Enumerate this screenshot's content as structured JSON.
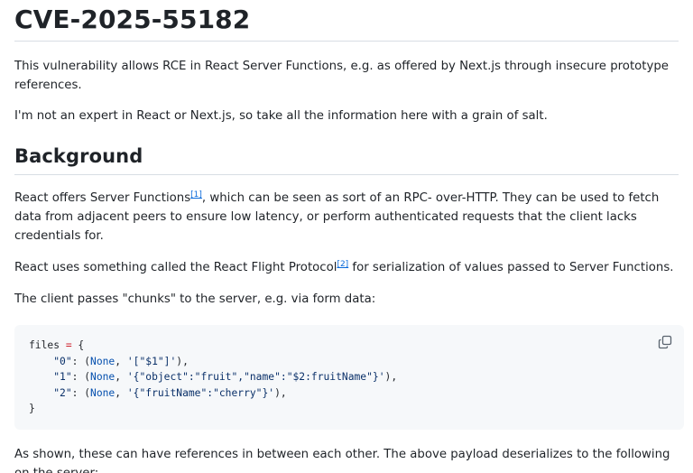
{
  "article": {
    "title": "CVE-2025-55182",
    "intro_p1": "This vulnerability allows RCE in React Server Functions, e.g. as offered by Next.js through insecure prototype references.",
    "intro_p2": "I'm not an expert in React or Next.js, so take all the information here with a grain of salt.",
    "background": {
      "heading": "Background",
      "p1_before": "React offers Server Functions",
      "p1_ref": "[1]",
      "p1_after": ", which can be seen as sort of an RPC- over-HTTP. They can be used to fetch data from adjacent peers to ensure low latency, or perform authenticated requests that the client lacks credentials for.",
      "p2_before": "React uses something called the React Flight Protocol",
      "p2_ref": "[2]",
      "p2_after": " for serialization of values passed to Server Functions.",
      "p3": "The client passes \"chunks\" to the server, e.g. via form data:",
      "p4": "As shown, these can have references in between each other. The above payload deserializes to the following on the server:"
    },
    "code": {
      "line1_a": "files ",
      "line1_op": "=",
      "line1_b": " {",
      "line2_key": "\"0\"",
      "line2_a": ": (",
      "line2_kw": "None",
      "line2_b": ", ",
      "line2_str": "'[\"$1\"]'",
      "line2_c": "),",
      "line3_key": "\"1\"",
      "line3_a": ": (",
      "line3_kw": "None",
      "line3_b": ", ",
      "line3_str": "'{\"object\":\"fruit\",\"name\":\"$2:fruitName\"}'",
      "line3_c": "),",
      "line4_key": "\"2\"",
      "line4_a": ": (",
      "line4_kw": "None",
      "line4_b": ", ",
      "line4_str": "'{\"fruitName\":\"cherry\"}'",
      "line4_c": "),",
      "line5": "}",
      "copy_icon": "copy-icon"
    }
  },
  "colors": {
    "text": "#1f2328",
    "link": "#0969da",
    "code_bg": "#f6f8fa",
    "divider": "#d8dee4"
  }
}
